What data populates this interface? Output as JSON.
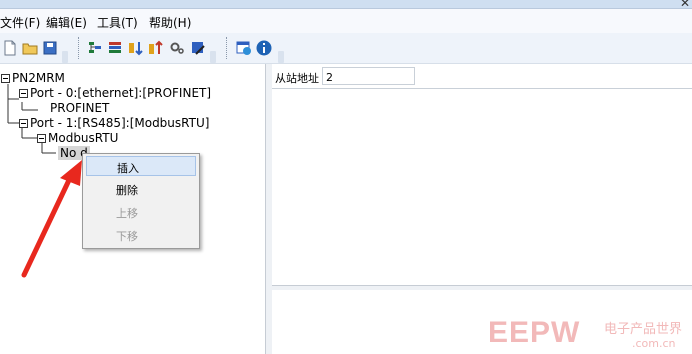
{
  "menu": [
    {
      "label": "文件(F)"
    },
    {
      "label": "编辑(E)"
    },
    {
      "label": "工具(T)"
    },
    {
      "label": "帮助(H)"
    }
  ],
  "toolbar": {
    "icons": [
      "new-file-icon",
      "open-folder-icon",
      "save-icon",
      "tool1-icon",
      "tool2-icon",
      "tool3-icon",
      "tool4-icon",
      "settings-icon",
      "edit-icon",
      "help-window-icon",
      "info-icon"
    ]
  },
  "tree": {
    "root": "PN2MRM",
    "port0": "Port - 0:[ethernet]:[PROFINET]",
    "profinet": "PROFINET",
    "port1": "Port - 1:[RS485]:[ModbusRTU]",
    "modbus": "ModbusRTU",
    "node": "No d"
  },
  "context_menu": {
    "items": [
      {
        "label": "插入",
        "enabled": true
      },
      {
        "label": "删除",
        "enabled": true
      },
      {
        "label": "上移",
        "enabled": false
      },
      {
        "label": "下移",
        "enabled": false
      }
    ]
  },
  "properties": {
    "slave_address_label": "从站地址",
    "slave_address_value": "2"
  },
  "watermark": {
    "brand": "EEPW",
    "cn": "电子产品世界",
    "url": ".com.cn"
  },
  "colors": {
    "arrow": "#e8281e",
    "watermark": "#f2b9b9"
  }
}
